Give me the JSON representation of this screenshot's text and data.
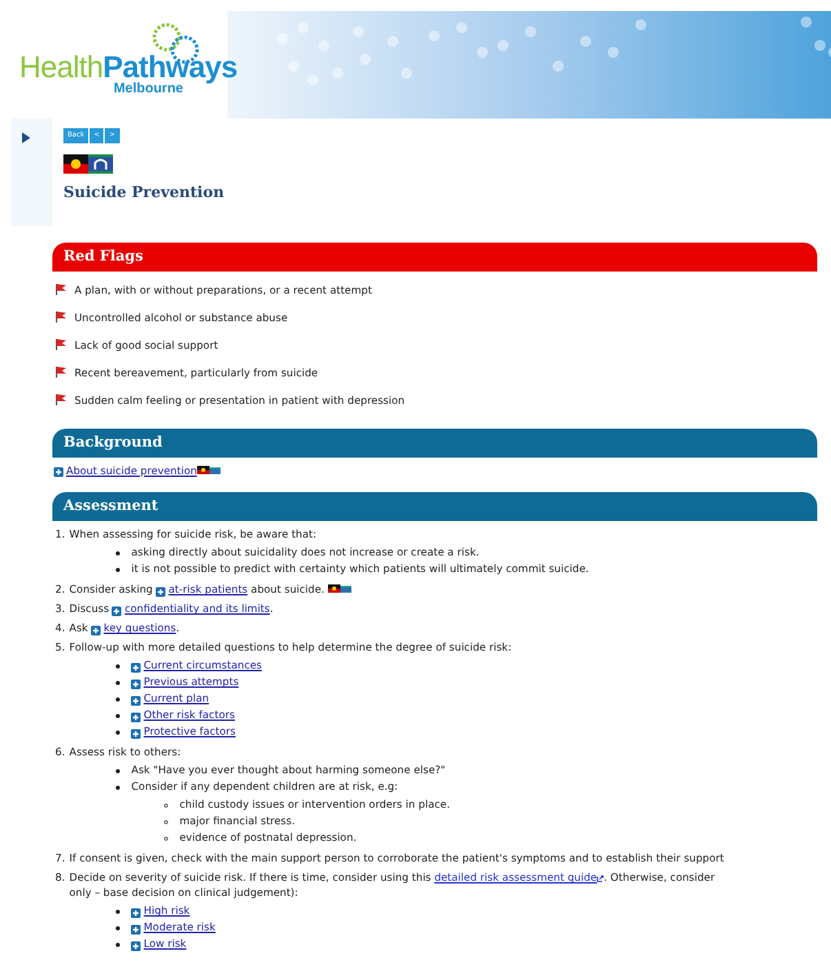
{
  "header": {
    "brand_first": "Health",
    "brand_second": "Pathways",
    "region": "Melbourne"
  },
  "nav_buttons": [
    "Back",
    "<",
    ">"
  ],
  "page_title": "Suicide Prevention",
  "sections": [
    {
      "kind": "red_flags",
      "title": "Red Flags",
      "items": [
        "A plan, with or without preparations, or a recent attempt",
        "Uncontrolled alcohol or substance abuse",
        "Lack of good social support",
        "Recent bereavement, particularly from suicide",
        "Sudden calm feeling or presentation in patient with depression"
      ]
    },
    {
      "kind": "links",
      "title": "Background",
      "items": [
        {
          "parts": [
            {
              "kind": "link",
              "text": "About suicide prevention"
            },
            {
              "kind": "flags"
            }
          ]
        }
      ]
    },
    {
      "kind": "steps",
      "title": "Assessment",
      "items": [
        {
          "number": "1.",
          "parts": [
            {
              "kind": "text",
              "text": "When assessing for suicide risk, be aware that:"
            }
          ],
          "children": [
            {
              "parts": [
                {
                  "kind": "text",
                  "text": "asking directly about suicidality does not increase or create a risk."
                }
              ]
            },
            {
              "parts": [
                {
                  "kind": "text",
                  "text": "it is not possible to predict with certainty which patients will ultimately commit suicide."
                }
              ]
            }
          ]
        },
        {
          "number": "2.",
          "parts": [
            {
              "kind": "text",
              "text": "Consider asking "
            },
            {
              "kind": "link",
              "text": "at-risk patients"
            },
            {
              "kind": "text",
              "text": " about suicide. "
            },
            {
              "kind": "flags"
            }
          ]
        },
        {
          "number": "3.",
          "parts": [
            {
              "kind": "text",
              "text": "Discuss "
            },
            {
              "kind": "link",
              "text": "confidentiality and its limits"
            },
            {
              "kind": "text",
              "text": "."
            }
          ]
        },
        {
          "number": "4.",
          "parts": [
            {
              "kind": "text",
              "text": "Ask "
            },
            {
              "kind": "link",
              "text": "key questions"
            },
            {
              "kind": "text",
              "text": "."
            }
          ]
        },
        {
          "number": "5.",
          "parts": [
            {
              "kind": "text",
              "text": "Follow-up with more detailed questions to help determine the degree of suicide risk:"
            }
          ],
          "children": [
            {
              "parts": [
                {
                  "kind": "link",
                  "text": "Current circumstances"
                }
              ]
            },
            {
              "parts": [
                {
                  "kind": "link",
                  "text": "Previous attempts"
                }
              ]
            },
            {
              "parts": [
                {
                  "kind": "link",
                  "text": "Current plan"
                }
              ]
            },
            {
              "parts": [
                {
                  "kind": "link",
                  "text": "Other risk factors"
                }
              ]
            },
            {
              "parts": [
                {
                  "kind": "link",
                  "text": "Protective factors"
                }
              ]
            }
          ]
        },
        {
          "number": "6.",
          "parts": [
            {
              "kind": "text",
              "text": "Assess risk to others:"
            }
          ],
          "children": [
            {
              "parts": [
                {
                  "kind": "text",
                  "text": "Ask \"Have you ever thought about harming someone else?\""
                }
              ]
            },
            {
              "parts": [
                {
                  "kind": "text",
                  "text": "Consider if any dependent children are at risk, e.g:"
                }
              ],
              "children": [
                {
                  "parts": [
                    {
                      "kind": "text",
                      "text": "child custody issues or intervention orders in place."
                    }
                  ]
                },
                {
                  "parts": [
                    {
                      "kind": "text",
                      "text": "major financial stress."
                    }
                  ]
                },
                {
                  "parts": [
                    {
                      "kind": "text",
                      "text": "evidence of postnatal depression."
                    }
                  ]
                }
              ]
            }
          ]
        },
        {
          "number": "7.",
          "parts": [
            {
              "kind": "text",
              "text": "If consent is given, check with the main support person to corroborate the patient's symptoms and to establish their support"
            }
          ]
        },
        {
          "number": "8.",
          "parts": [
            {
              "kind": "text",
              "text": "Decide on severity of suicide risk. If there is time, consider using this "
            },
            {
              "kind": "external_link",
              "text": "detailed risk assessment guide"
            },
            {
              "kind": "text",
              "text": ". Otherwise, consider"
            },
            {
              "kind": "break"
            },
            {
              "kind": "text",
              "text": "only – base decision on clinical judgement):"
            }
          ],
          "children": [
            {
              "parts": [
                {
                  "kind": "link",
                  "text": "High risk"
                }
              ]
            },
            {
              "parts": [
                {
                  "kind": "link",
                  "text": "Moderate risk"
                }
              ]
            },
            {
              "parts": [
                {
                  "kind": "link",
                  "text": "Low risk"
                }
              ]
            }
          ]
        }
      ]
    }
  ]
}
